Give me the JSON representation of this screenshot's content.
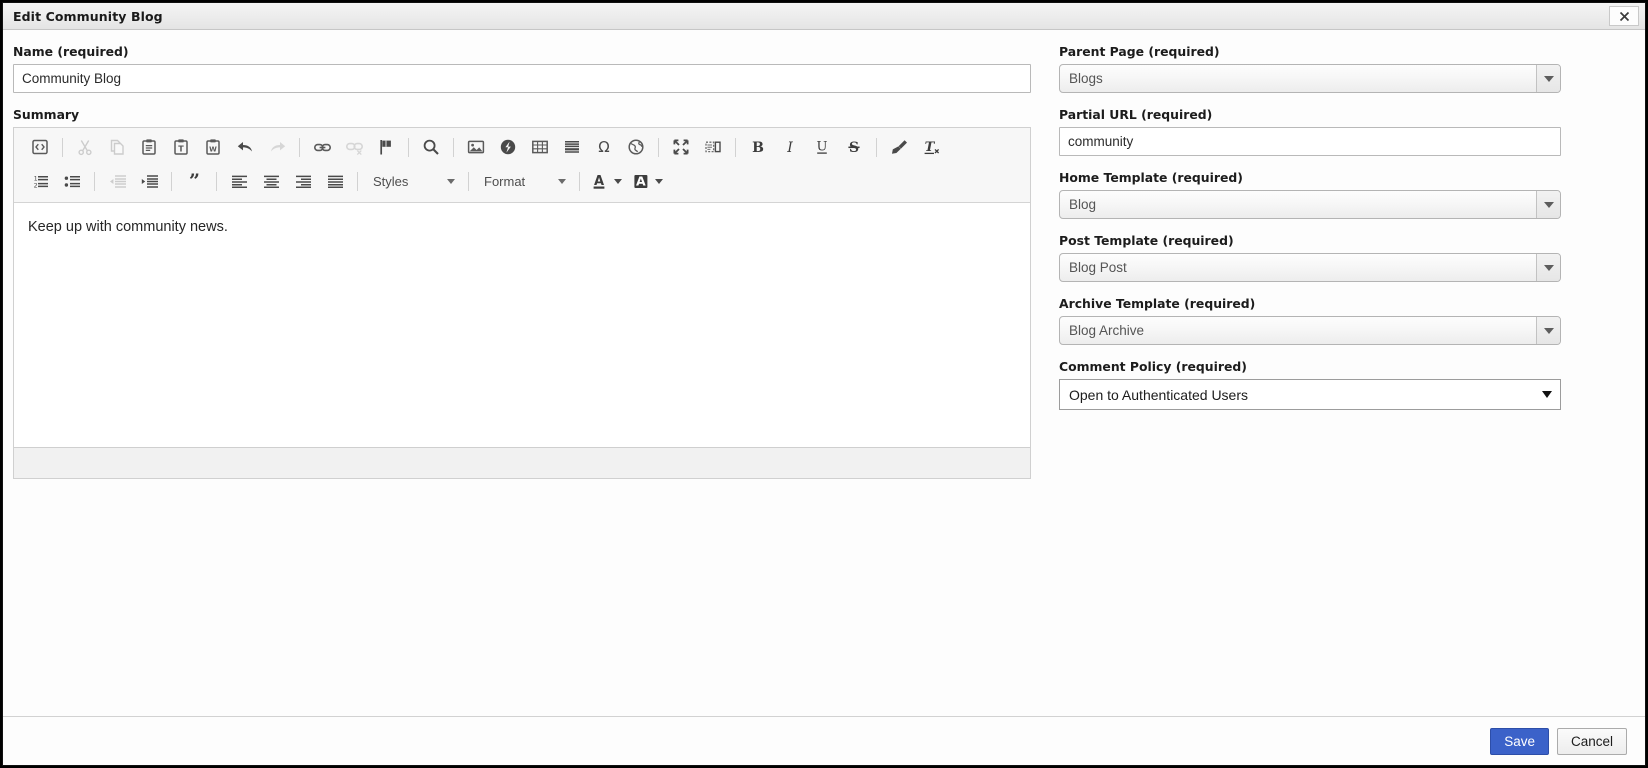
{
  "window": {
    "title": "Edit Community Blog",
    "close_label": "Close"
  },
  "left": {
    "name": {
      "label": "Name (required)",
      "value": "Community Blog",
      "placeholder": "Name"
    },
    "summary": {
      "label": "Summary",
      "content": "Keep up with community news."
    }
  },
  "toolbar": {
    "row1": [
      {
        "name": "source-icon",
        "title": "Source",
        "disabled": false
      },
      {
        "name": "separator",
        "title": "",
        "disabled": false
      },
      {
        "name": "cut-icon",
        "title": "Cut",
        "disabled": true
      },
      {
        "name": "copy-icon",
        "title": "Copy",
        "disabled": true
      },
      {
        "name": "paste-icon",
        "title": "Paste",
        "disabled": false
      },
      {
        "name": "paste-text-icon",
        "title": "Paste as plain text",
        "disabled": false
      },
      {
        "name": "paste-word-icon",
        "title": "Paste from Word",
        "disabled": false
      },
      {
        "name": "undo-icon",
        "title": "Undo",
        "disabled": false
      },
      {
        "name": "redo-icon",
        "title": "Redo",
        "disabled": true
      },
      {
        "name": "separator",
        "title": "",
        "disabled": false
      },
      {
        "name": "link-icon",
        "title": "Link",
        "disabled": false
      },
      {
        "name": "unlink-icon",
        "title": "Unlink",
        "disabled": true
      },
      {
        "name": "anchor-flag-icon",
        "title": "Anchor",
        "disabled": false
      },
      {
        "name": "separator",
        "title": "",
        "disabled": false
      },
      {
        "name": "search-icon",
        "title": "Find",
        "disabled": false
      },
      {
        "name": "separator",
        "title": "",
        "disabled": false
      },
      {
        "name": "image-icon",
        "title": "Image",
        "disabled": false
      },
      {
        "name": "flash-icon",
        "title": "Flash",
        "disabled": false
      },
      {
        "name": "table-icon",
        "title": "Table",
        "disabled": false
      },
      {
        "name": "horizontal-rule-icon",
        "title": "Horizontal Line",
        "disabled": false
      },
      {
        "name": "special-char-icon",
        "title": "Special Character",
        "disabled": false
      },
      {
        "name": "iframe-globe-icon",
        "title": "IFrame",
        "disabled": false
      },
      {
        "name": "separator",
        "title": "",
        "disabled": false
      },
      {
        "name": "maximize-icon",
        "title": "Maximize",
        "disabled": false
      },
      {
        "name": "show-blocks-icon",
        "title": "Show Blocks",
        "disabled": false
      },
      {
        "name": "separator",
        "title": "",
        "disabled": false
      },
      {
        "name": "bold-icon",
        "title": "Bold",
        "disabled": false
      },
      {
        "name": "italic-icon",
        "title": "Italic",
        "disabled": false
      },
      {
        "name": "underline-icon",
        "title": "Underline",
        "disabled": false
      },
      {
        "name": "strikethrough-icon",
        "title": "Strikethrough",
        "disabled": false
      },
      {
        "name": "separator",
        "title": "",
        "disabled": false
      },
      {
        "name": "copy-formatting-icon",
        "title": "Copy Formatting",
        "disabled": false
      },
      {
        "name": "remove-format-icon",
        "title": "Remove Format",
        "disabled": false
      }
    ],
    "row2": [
      {
        "name": "numbered-list-icon",
        "title": "Insert/Remove Numbered List",
        "disabled": false
      },
      {
        "name": "bulleted-list-icon",
        "title": "Insert/Remove Bulleted List",
        "disabled": false
      },
      {
        "name": "separator",
        "title": "",
        "disabled": false
      },
      {
        "name": "outdent-icon",
        "title": "Decrease Indent",
        "disabled": true
      },
      {
        "name": "indent-icon",
        "title": "Increase Indent",
        "disabled": false
      },
      {
        "name": "separator",
        "title": "",
        "disabled": false
      },
      {
        "name": "blockquote-icon",
        "title": "Block Quote",
        "disabled": false
      },
      {
        "name": "separator",
        "title": "",
        "disabled": false
      },
      {
        "name": "align-left-icon",
        "title": "Align Left",
        "disabled": false
      },
      {
        "name": "align-center-icon",
        "title": "Center",
        "disabled": false
      },
      {
        "name": "align-right-icon",
        "title": "Align Right",
        "disabled": false
      },
      {
        "name": "justify-icon",
        "title": "Justify",
        "disabled": false
      }
    ],
    "styles_label": "Styles",
    "format_label": "Format",
    "text_color_label": "Text Color",
    "bg_color_label": "Background Color"
  },
  "right": {
    "parent_page": {
      "label": "Parent Page (required)",
      "value": "Blogs",
      "type": "combo"
    },
    "partial_url": {
      "label": "Partial URL (required)",
      "value": "community",
      "type": "text"
    },
    "home_template": {
      "label": "Home Template (required)",
      "value": "Blog",
      "type": "combo"
    },
    "post_template": {
      "label": "Post Template (required)",
      "value": "Blog Post",
      "type": "combo"
    },
    "archive_template": {
      "label": "Archive Template (required)",
      "value": "Blog Archive",
      "type": "combo"
    },
    "comment_policy": {
      "label": "Comment Policy (required)",
      "value": "Open to Authenticated Users",
      "type": "select"
    }
  },
  "footer": {
    "save_label": "Save",
    "cancel_label": "Cancel"
  },
  "colors": {
    "primary": "#3b62c9",
    "window_bg": "#fdfdfd",
    "titlebar_bg": "#ececec",
    "toolbar_bg": "#f7f7f7",
    "icon": "#5a5a5a"
  }
}
